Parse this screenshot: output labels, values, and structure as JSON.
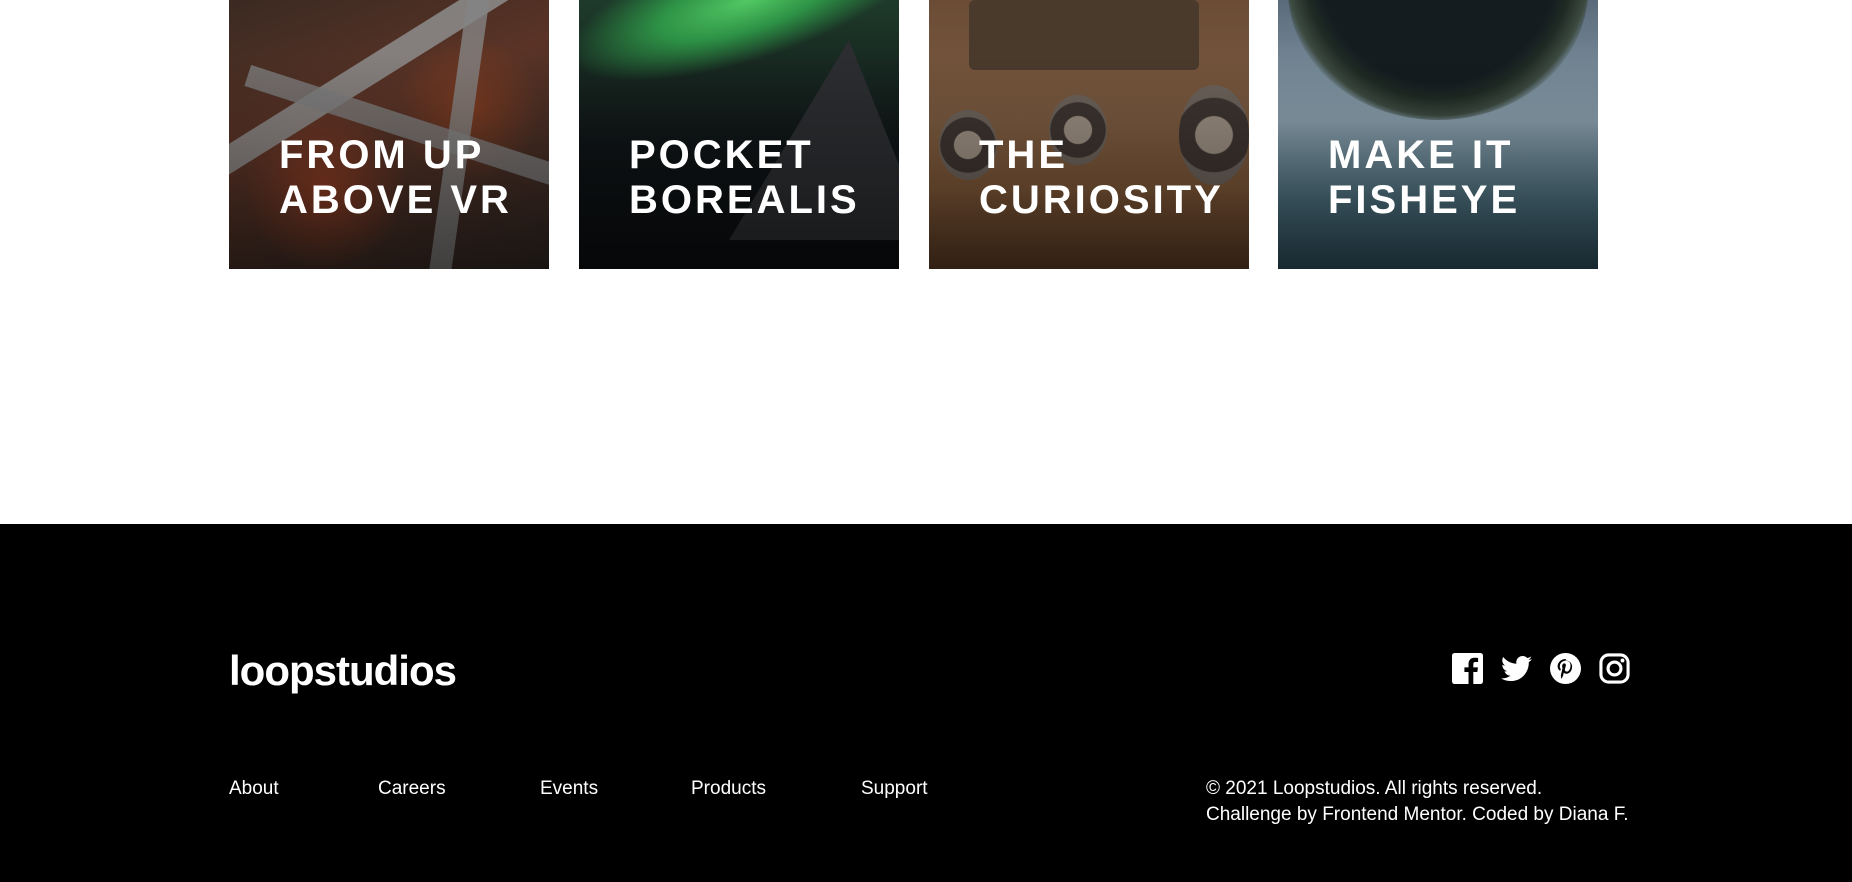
{
  "gallery": {
    "cards": [
      {
        "line1": "FROM UP",
        "line2": "ABOVE VR"
      },
      {
        "line1": "POCKET",
        "line2": "BOREALIS"
      },
      {
        "line1": "THE",
        "line2": "CURIOSITY"
      },
      {
        "line1": "MAKE IT",
        "line2": "FISHEYE"
      }
    ]
  },
  "footer": {
    "logo": "loopstudios",
    "social": [
      "facebook-icon",
      "twitter-icon",
      "pinterest-icon",
      "instagram-icon"
    ],
    "nav": [
      "About",
      "Careers",
      "Events",
      "Products",
      "Support"
    ],
    "copyright": "© 2021 Loopstudios. All rights reserved.",
    "credit": "Challenge by Frontend Mentor. Coded by Diana F."
  },
  "colors": {
    "footer_bg": "#000000",
    "text_light": "#ffffff",
    "page_bg": "#ffffff"
  }
}
